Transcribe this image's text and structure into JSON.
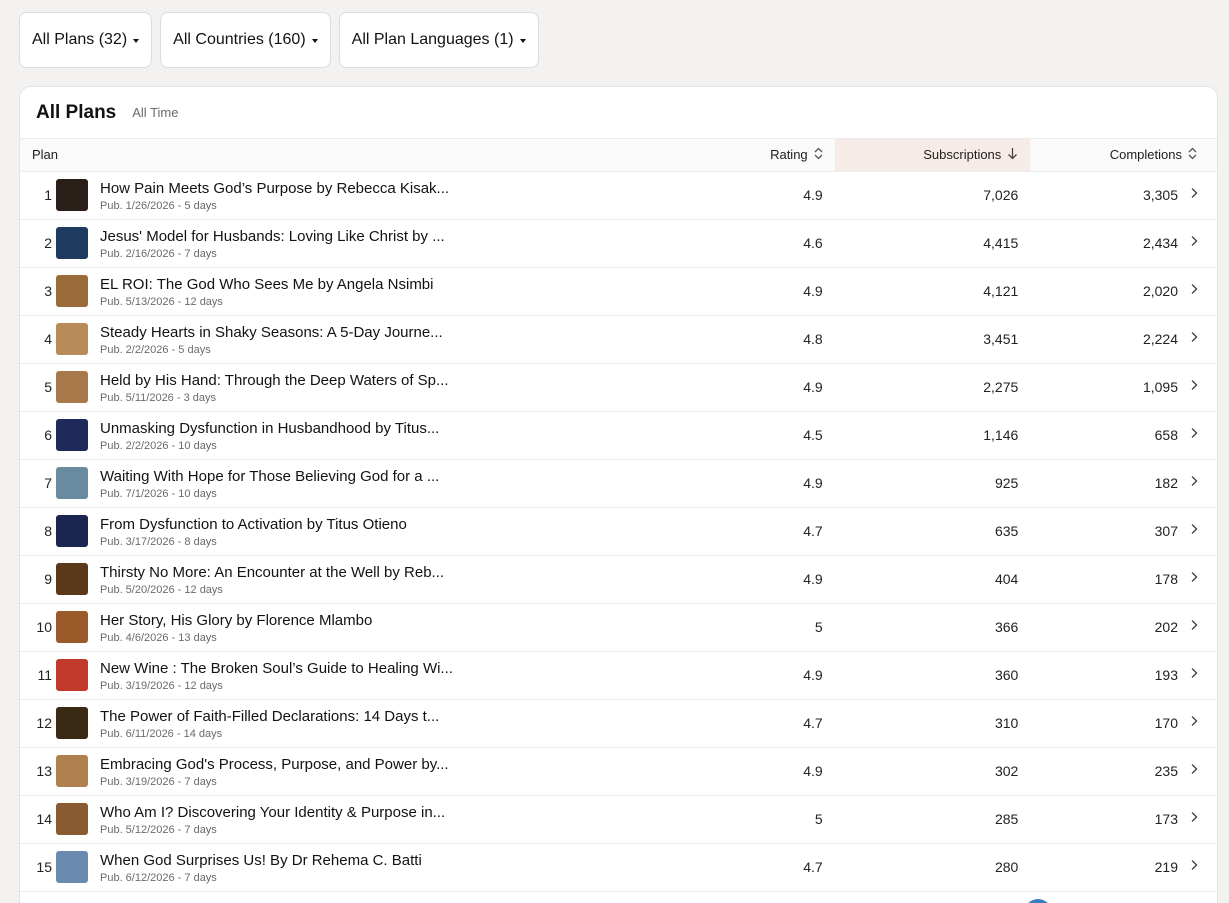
{
  "filters": {
    "plans": "All Plans (32)",
    "countries": "All Countries (160)",
    "languages": "All Plan Languages (1)"
  },
  "card": {
    "title": "All Plans",
    "subtitle": "All Time"
  },
  "columns": {
    "plan": "Plan",
    "rating": "Rating",
    "subscriptions": "Subscriptions",
    "completions": "Completions"
  },
  "icons": {
    "sortable": "up-down-chevron-icon",
    "sorted_desc": "arrow-down-icon",
    "row_action": "chevron-right-icon",
    "dropdown": "caret-down-icon"
  },
  "colors": {
    "sorted_column_bg": "#f7ebe7",
    "page_bg": "#f3f2f1"
  },
  "rows": [
    {
      "rank": "1",
      "title": "How Pain Meets God’s Purpose by Rebecca Kisak...",
      "meta": "Pub. 1/26/2026 - 5 days",
      "rating": "4.9",
      "subscriptions": "7,026",
      "completions": "3,305",
      "thumb": "#2a1f18"
    },
    {
      "rank": "2",
      "title": "Jesus' Model for Husbands: Loving Like Christ by ...",
      "meta": "Pub. 2/16/2026 - 7 days",
      "rating": "4.6",
      "subscriptions": "4,415",
      "completions": "2,434",
      "thumb": "#1f3a5f"
    },
    {
      "rank": "3",
      "title": "EL ROI: The God Who Sees Me by Angela Nsimbi",
      "meta": "Pub. 5/13/2026 - 12 days",
      "rating": "4.9",
      "subscriptions": "4,121",
      "completions": "2,020",
      "thumb": "#9a6a3a"
    },
    {
      "rank": "4",
      "title": "Steady Hearts in Shaky Seasons: A 5-Day Journe...",
      "meta": "Pub. 2/2/2026 - 5 days",
      "rating": "4.8",
      "subscriptions": "3,451",
      "completions": "2,224",
      "thumb": "#b98a5a"
    },
    {
      "rank": "5",
      "title": "Held by His Hand: Through the Deep Waters of Sp...",
      "meta": "Pub. 5/11/2026 - 3 days",
      "rating": "4.9",
      "subscriptions": "2,275",
      "completions": "1,095",
      "thumb": "#a8784a"
    },
    {
      "rank": "6",
      "title": "Unmasking Dysfunction in Husbandhood by Titus...",
      "meta": "Pub. 2/2/2026 - 10 days",
      "rating": "4.5",
      "subscriptions": "1,146",
      "completions": "658",
      "thumb": "#1d2a5a"
    },
    {
      "rank": "7",
      "title": "Waiting With Hope for Those Believing God for a ...",
      "meta": "Pub. 7/1/2026 - 10 days",
      "rating": "4.9",
      "subscriptions": "925",
      "completions": "182",
      "thumb": "#6a8aa0"
    },
    {
      "rank": "8",
      "title": "From Dysfunction to Activation by Titus Otieno",
      "meta": "Pub. 3/17/2026 - 8 days",
      "rating": "4.7",
      "subscriptions": "635",
      "completions": "307",
      "thumb": "#1a2550"
    },
    {
      "rank": "9",
      "title": "Thirsty No More: An Encounter at the Well by Reb...",
      "meta": "Pub. 5/20/2026 - 12 days",
      "rating": "4.9",
      "subscriptions": "404",
      "completions": "178",
      "thumb": "#5a3a1a"
    },
    {
      "rank": "10",
      "title": "Her Story, His Glory by Florence Mlambo",
      "meta": "Pub. 4/6/2026 - 13 days",
      "rating": "5",
      "subscriptions": "366",
      "completions": "202",
      "thumb": "#9a5a2a"
    },
    {
      "rank": "11",
      "title": "New Wine : The Broken Soul’s Guide to Healing Wi...",
      "meta": "Pub. 3/19/2026 - 12 days",
      "rating": "4.9",
      "subscriptions": "360",
      "completions": "193",
      "thumb": "#c0392b"
    },
    {
      "rank": "12",
      "title": "The Power of Faith-Filled Declarations: 14 Days t...",
      "meta": "Pub. 6/11/2026 - 14 days",
      "rating": "4.7",
      "subscriptions": "310",
      "completions": "170",
      "thumb": "#3a2a14"
    },
    {
      "rank": "13",
      "title": "Embracing God's Process, Purpose, and Power by...",
      "meta": "Pub. 3/19/2026 - 7 days",
      "rating": "4.9",
      "subscriptions": "302",
      "completions": "235",
      "thumb": "#b08050"
    },
    {
      "rank": "14",
      "title": "Who Am I? Discovering Your Identity & Purpose in...",
      "meta": "Pub. 5/12/2026 - 7 days",
      "rating": "5",
      "subscriptions": "285",
      "completions": "173",
      "thumb": "#8a5a30"
    },
    {
      "rank": "15",
      "title": "When God Surprises Us! By Dr Rehema C. Batti",
      "meta": "Pub. 6/12/2026 - 7 days",
      "rating": "4.7",
      "subscriptions": "280",
      "completions": "219",
      "thumb": "#6a8ab0"
    }
  ]
}
